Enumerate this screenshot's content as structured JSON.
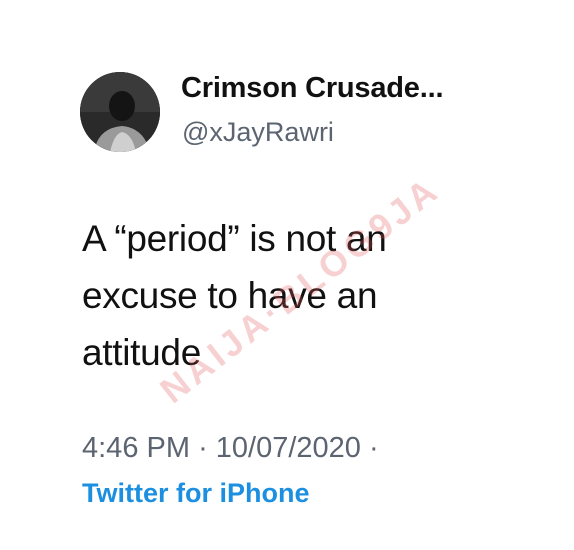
{
  "tweet": {
    "display_name": "Crimson Crusade...",
    "handle": "@xJayRawri",
    "text_lines": [
      "A “period” is not an",
      "excuse to have an",
      "attitude"
    ],
    "time": "4:46 PM",
    "separator": "·",
    "date": "10/07/2020",
    "source": "Twitter for iPhone",
    "avatar_icon": "profile-photo"
  },
  "watermark": {
    "text": "NAIJA·BLOG9JA",
    "color": "#e15a5a"
  },
  "colors": {
    "name": "#111111",
    "handle": "#5b6470",
    "source_link": "#1d8fe0"
  }
}
